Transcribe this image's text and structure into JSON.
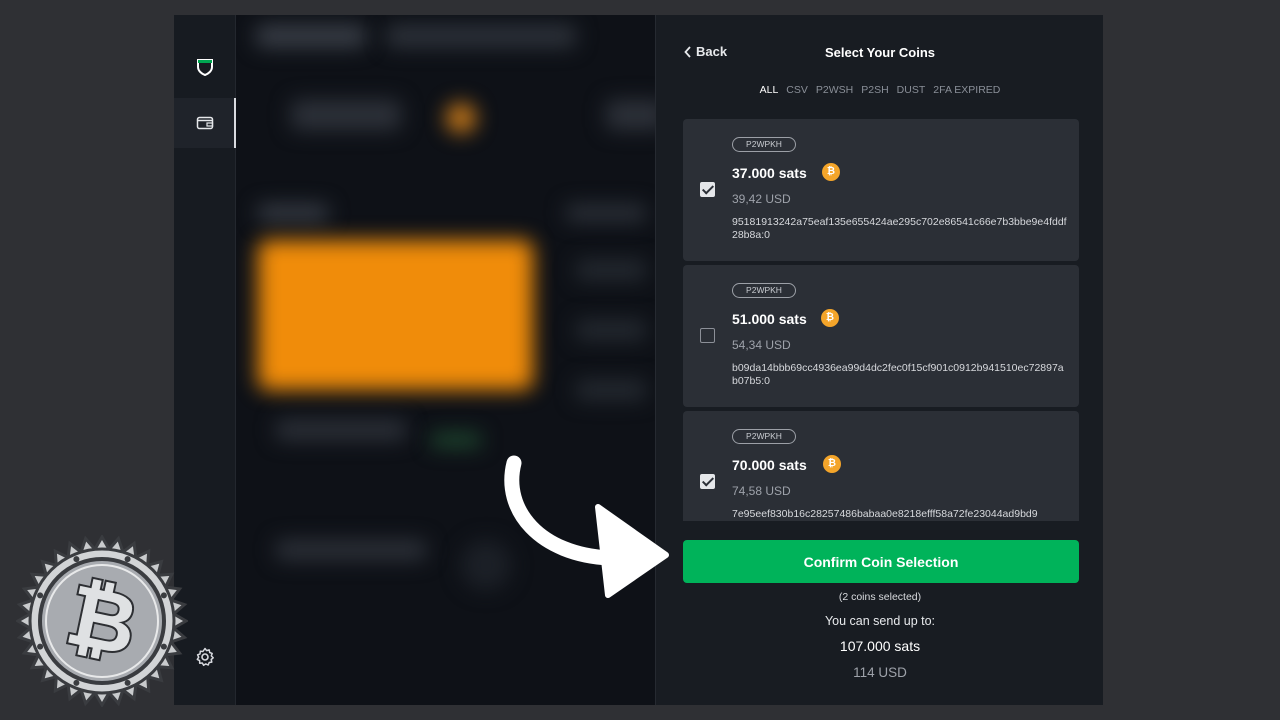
{
  "panel": {
    "back_label": "Back",
    "title": "Select Your Coins",
    "filters": [
      "ALL",
      "CSV",
      "P2WSH",
      "P2SH",
      "DUST",
      "2FA EXPIRED"
    ],
    "active_filter": "ALL"
  },
  "coins": [
    {
      "type": "P2WPKH",
      "amount": "37.000 sats",
      "usd": "39,42 USD",
      "txid": "95181913242a75eaf135e655424ae295c702e86541c66e7b3bbe9e4fddf28b8a:0",
      "checked": true
    },
    {
      "type": "P2WPKH",
      "amount": "51.000 sats",
      "usd": "54,34 USD",
      "txid": "b09da14bbb69cc4936ea99d4dc2fec0f15cf901c0912b941510ec72897ab07b5:0",
      "checked": false
    },
    {
      "type": "P2WPKH",
      "amount": "70.000 sats",
      "usd": "74,58 USD",
      "txid": "7e95eef830b16c28257486babaa0e8218efff58a72fe23044ad9bd9",
      "checked": true
    }
  ],
  "coin_glyph": "₿",
  "confirm_label": "Confirm Coin Selection",
  "summary": {
    "selected": "(2 coins selected)",
    "send_label": "You can send up to:",
    "send_sats": "107.000 sats",
    "send_usd": "114 USD"
  },
  "badge_glyph": "₿",
  "colors": {
    "accent": "#00b35a",
    "bitcoin": "#f4a52a",
    "brand": "#00a651"
  },
  "icons": [
    "chevron-left-icon",
    "bitcoin-icon",
    "wallet-icon",
    "gear-icon",
    "shield-logo-icon"
  ]
}
